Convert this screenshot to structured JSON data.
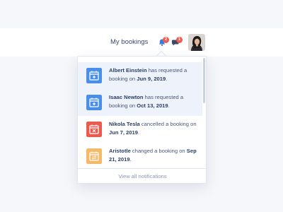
{
  "header": {
    "nav_link": "My bookings",
    "bell_badge": "2",
    "chat_badge": "1"
  },
  "notifications": [
    {
      "name": "Albert Einstein",
      "action": " has requested a booking on ",
      "date": "Jun 9, 2019",
      "end": ".",
      "icon": "calendar-plus-icon",
      "color": "#4a8fe7",
      "unread": true
    },
    {
      "name": "Isaac Newton",
      "action": " has requested a booking on ",
      "date": "Oct 13, 2019",
      "end": ".",
      "icon": "calendar-plus-icon",
      "color": "#4a8fe7",
      "unread": true
    },
    {
      "name": "Nikola Tesla",
      "action": " cancelled a booking on ",
      "date": "Jun 7, 2019",
      "end": ".",
      "icon": "calendar-x-icon",
      "color": "#ea5b4f",
      "unread": false
    },
    {
      "name": "Aristotle",
      "action": " changed a booking on ",
      "date": "Sep 21, 2019",
      "end": ".",
      "icon": "calendar-change-icon",
      "color": "#f5b96a",
      "unread": false
    }
  ],
  "footer": {
    "label": "View all notifications"
  },
  "colors": {
    "accent": "#4a8fe7",
    "badge": "#ef5a4e"
  }
}
